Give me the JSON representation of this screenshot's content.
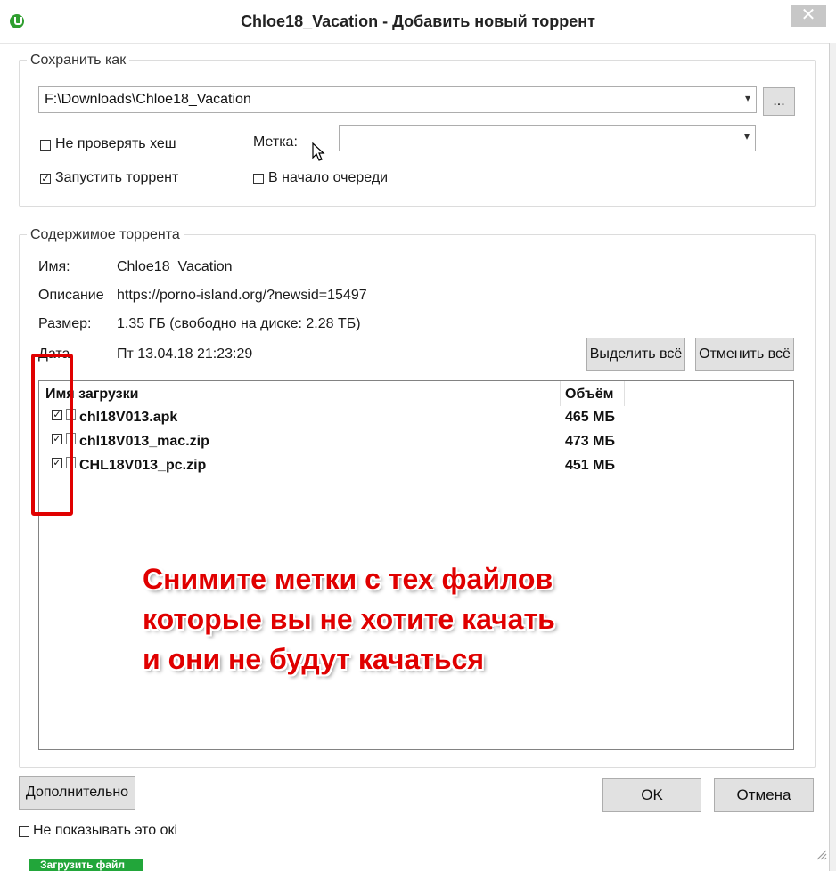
{
  "window": {
    "title": "Chloe18_Vacation - Добавить новый торрент",
    "close_glyph": "✕"
  },
  "save_as": {
    "legend": "Сохранить как",
    "path_value": "F:\\Downloads\\Chloe18_Vacation",
    "browse_label": "...",
    "skip_hash_label": "Не проверять хеш",
    "skip_hash_checked": false,
    "label_caption": "Метка:",
    "label_value": "",
    "start_torrent_label": "Запустить торрент",
    "start_torrent_checked": true,
    "queue_top_label": "В начало очереди",
    "queue_top_checked": false
  },
  "contents": {
    "legend": "Содержимое торрента",
    "name_caption": "Имя:",
    "name_value": "Chloe18_Vacation",
    "desc_caption": "Описание",
    "desc_value": "https://porno-island.org/?newsid=15497",
    "size_caption": "Размер:",
    "size_value": "1.35 ГБ (свободно на диске: 2.28 ТБ)",
    "date_caption": "Дата",
    "date_value": "Пт 13.04.18 21:23:29",
    "select_all_label": "Выделить всё",
    "deselect_all_label": "Отменить всё",
    "columns": {
      "name": "Имя загрузки",
      "size": "Объём"
    },
    "files": [
      {
        "name": "chl18V013.apk",
        "size": "465 МБ",
        "checked": true
      },
      {
        "name": "chl18V013_mac.zip",
        "size": "473 МБ",
        "checked": true
      },
      {
        "name": "CHL18V013_pc.zip",
        "size": "451 МБ",
        "checked": true
      }
    ]
  },
  "overlay": {
    "line1": "Снимите метки с тех файлов",
    "line2": "которые вы не хотите качать",
    "line3": "и они не будут качаться",
    "color": "#e00000"
  },
  "footer": {
    "advanced_label": "Дополнительно",
    "ok_label": "OK",
    "cancel_label": "Отмена",
    "dont_show_label": "Не показывать это окі",
    "dont_show_checked": false
  },
  "background": {
    "green_button_label": "Загрузить файл"
  }
}
